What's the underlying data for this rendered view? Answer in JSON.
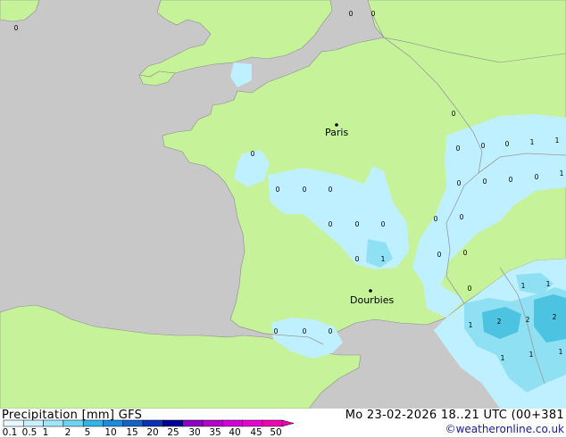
{
  "map": {
    "cities": [
      {
        "name": "Paris"
      },
      {
        "name": "Dourbies"
      }
    ],
    "values": [
      {
        "text": "0"
      },
      {
        "text": "0"
      },
      {
        "text": "0"
      },
      {
        "text": "0"
      },
      {
        "text": "0"
      },
      {
        "text": "0"
      },
      {
        "text": "0"
      },
      {
        "text": "1"
      },
      {
        "text": "0"
      },
      {
        "text": "0"
      },
      {
        "text": "0"
      },
      {
        "text": "0"
      },
      {
        "text": "0"
      },
      {
        "text": "0"
      },
      {
        "text": "0"
      },
      {
        "text": "0"
      },
      {
        "text": "0"
      },
      {
        "text": "0"
      },
      {
        "text": "0"
      },
      {
        "text": "1"
      },
      {
        "text": "1"
      },
      {
        "text": "0"
      },
      {
        "text": "0"
      },
      {
        "text": "0"
      },
      {
        "text": "0"
      },
      {
        "text": "0"
      },
      {
        "text": "1"
      },
      {
        "text": "1"
      },
      {
        "text": "1"
      },
      {
        "text": "2"
      },
      {
        "text": "2"
      },
      {
        "text": "2"
      },
      {
        "text": "1"
      },
      {
        "text": "1"
      },
      {
        "text": "1"
      },
      {
        "text": "1"
      },
      {
        "text": "0"
      },
      {
        "text": "0"
      },
      {
        "text": "0"
      },
      {
        "text": "0"
      }
    ],
    "colors": {
      "land": "#c6f29a",
      "sea": "#c8c8c8",
      "precip_light": "#bff0ff",
      "precip_mid": "#8fe0f2",
      "precip_high": "#4cc3e0"
    }
  },
  "legend": {
    "title": "Precipitation [mm]  GFS",
    "time": "Mo 23-02-2026 18..21 UTC (00+381",
    "credit": "©weatheronline.co.uk",
    "ticks": [
      "0.1",
      "0.5",
      "1",
      "2",
      "5",
      "10",
      "15",
      "20",
      "25",
      "30",
      "35",
      "40",
      "45",
      "50"
    ],
    "colors": [
      "#e8f8ff",
      "#c8f0ff",
      "#a0e6fa",
      "#6cd4f0",
      "#32b4e6",
      "#1e8cdc",
      "#1464c8",
      "#0a32b4",
      "#000096",
      "#8c00c8",
      "#b400c8",
      "#d200d2",
      "#e600d2",
      "#f000b4"
    ]
  }
}
